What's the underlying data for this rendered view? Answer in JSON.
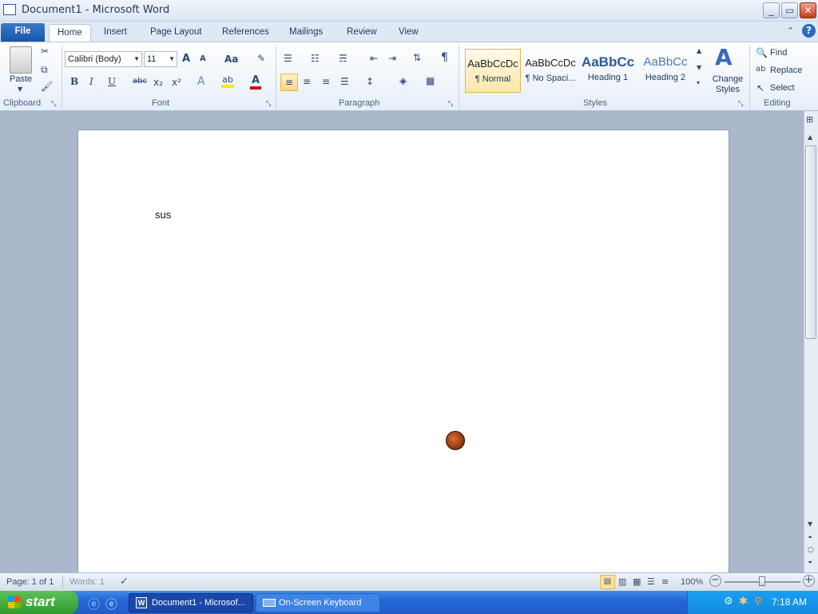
{
  "window": {
    "title": "Document1 - Microsoft Word",
    "minimize": "_",
    "restore": "▭",
    "close": "✕"
  },
  "tabs": [
    "File",
    "Home",
    "Insert",
    "Page Layout",
    "References",
    "Mailings",
    "Review",
    "View"
  ],
  "clipboard": {
    "paste": "Paste",
    "group": "Clipboard"
  },
  "font": {
    "family": "Calibri (Body)",
    "size": "11",
    "group": "Font",
    "bold": "B",
    "italic": "I",
    "underline": "U",
    "strike": "abc",
    "sub": "x₂",
    "sup": "x²",
    "grow": "A",
    "shrink": "A",
    "case": "Aa"
  },
  "paragraph": {
    "group": "Paragraph",
    "pilcrow": "¶"
  },
  "styles": {
    "group": "Styles",
    "items": [
      {
        "preview": "AaBbCcDc",
        "name": "¶ Normal"
      },
      {
        "preview": "AaBbCcDc",
        "name": "¶ No Spaci..."
      },
      {
        "preview": "AaBbCc",
        "name": "Heading 1"
      },
      {
        "preview": "AaBbCc",
        "name": "Heading 2"
      }
    ],
    "change_styles": "Change Styles"
  },
  "editing": {
    "group": "Editing",
    "find": "Find",
    "replace": "Replace",
    "select": "Select"
  },
  "document": {
    "text": "sus"
  },
  "status": {
    "page": "Page: 1 of 1",
    "words": "Words: 1",
    "zoom": "100%"
  },
  "taskbar": {
    "start": "start",
    "items": [
      "Document1 - Microsof...",
      "On-Screen Keyboard"
    ],
    "clock": "7:18 AM"
  },
  "colors": {
    "accent": "#1a56a8",
    "file_tab": "#2a6ac0",
    "start_green": "#3aa636"
  }
}
